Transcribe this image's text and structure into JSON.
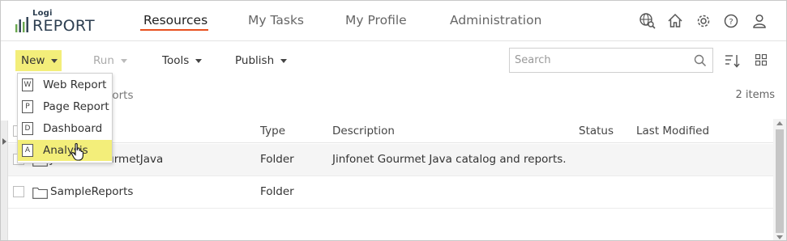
{
  "logo": {
    "small": "Logi",
    "big": "REPORT"
  },
  "nav": {
    "items": [
      {
        "label": "Resources",
        "active": true
      },
      {
        "label": "My Tasks"
      },
      {
        "label": "My Profile"
      },
      {
        "label": "Administration"
      }
    ]
  },
  "header_icons": [
    "globe-search-icon",
    "home-icon",
    "gear-icon",
    "help-icon",
    "user-icon"
  ],
  "toolbar": {
    "new_label": "New",
    "run_label": "Run",
    "tools_label": "Tools",
    "publish_label": "Publish",
    "search_placeholder": "Search"
  },
  "breadcrumb": {
    "text": "c Reports"
  },
  "items_count": "2 items",
  "new_menu": {
    "items": [
      {
        "label": "Web Report",
        "icon_letter": "W",
        "icon": "web-report-icon"
      },
      {
        "label": "Page Report",
        "icon_letter": "P",
        "icon": "page-report-icon"
      },
      {
        "label": "Dashboard",
        "icon_letter": "D",
        "icon": "dashboard-icon"
      },
      {
        "label": "Analysis",
        "icon_letter": "A",
        "icon": "analysis-icon",
        "highlighted": true
      }
    ]
  },
  "table": {
    "columns": [
      "Type",
      "Description",
      "Status",
      "Last Modified"
    ],
    "rows": [
      {
        "name": "JinfonetGourmetJava",
        "type": "Folder",
        "description": "Jinfonet Gourmet Java catalog and reports.",
        "status": "",
        "last_modified": ""
      },
      {
        "name": "SampleReports",
        "type": "Folder",
        "description": "",
        "status": "",
        "last_modified": ""
      }
    ]
  },
  "colors": {
    "accent_highlight": "#f3ee7a",
    "active_underline": "#e8501e",
    "logo_green": "#6aa84f"
  }
}
